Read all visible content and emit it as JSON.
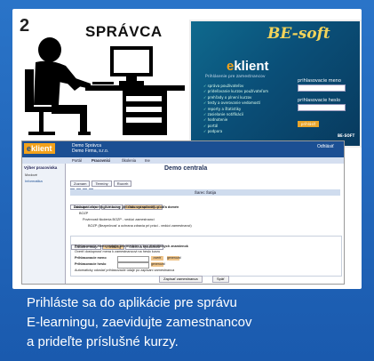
{
  "step_number": "2",
  "role_title": "SPRÁVCA",
  "caption_lines": [
    "Prihláste sa do aplikácie pre správu",
    "E-learningu, zaevidujte zamestnancov",
    "a prideľte príslušné kurzy."
  ],
  "login_screen": {
    "brand": "BE-soft",
    "logo_prefix": "e",
    "logo_rest": "klient",
    "subtitle": "Prihlásenie pre zamestnancov",
    "features": [
      "správa používateľov",
      "prideľovanie kurzov používateľom",
      "prehľady o plnení kurzov",
      "testy a overovanie vedomostí",
      "reporty a štatistiky",
      "zasielanie notifikácií",
      "hodnotenie",
      "portál",
      "podpora"
    ],
    "username_label": "prihlasovacie meno",
    "password_label": "prihlasovacie heslo",
    "submit_label": "prihlásiť",
    "corner_logo": "BE-SOFT"
  },
  "app_screen": {
    "logo_prefix": "e",
    "logo_rest": "klient",
    "header_lines": [
      "Demo Správca",
      "Demo Firma, s.r.o."
    ],
    "exit_label": "Odhlásiť",
    "menu_tabs": [
      "Portál",
      "Pracovníci",
      "Školenia",
      "Ine"
    ],
    "sidebar_title": "Výber pracoviska",
    "sidebar_items": [
      "Mzdové",
      "Informatika"
    ],
    "page_title": "Demo centrala",
    "sub_tabs": [
      "Zoznam",
      "Termíny",
      "Rozvrh"
    ],
    "box_header": "Šarec Šatija",
    "tabs2": [
      "Základné údaje",
      "E-learning",
      "Odborná spôsobilosť"
    ],
    "lines_1": [
      "Dostupné elearningové kurzy (zelenou vyznačené) - podľa domén",
      "BOZP",
      "Povinnosti školenia BOZP - vedúci zamestnanci",
      "BOZP (Bezpečnosť a ochrana zdravia pri práci - vedúci zamestnanci)"
    ],
    "tabs3": [
      "Základné údaje",
      "E-learning",
      "Odborná spôsobilosť"
    ],
    "lines_2": [
      "Prihlasovacie meno zadajte bez medzier s bez diakritických znamienok",
      "Overiť dostupnosť mena k zamestnancovi na heslo kurzu"
    ],
    "login_name_label": "Prihlasovacie meno",
    "password_label": "Prihlasovacie heslo",
    "check_label": "overiť",
    "generate_label": "generovať",
    "auto_label": "Automaticky odoslať prihlasovacie údaje po zapísaní zamestnanca",
    "bottom_buttons": [
      "Zapísať zamestnanca",
      "Späť"
    ]
  }
}
